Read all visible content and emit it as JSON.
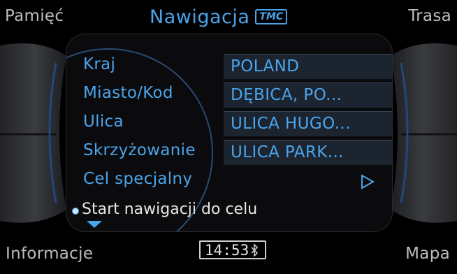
{
  "corners": {
    "top_left": "Pamięć",
    "top_right": "Trasa",
    "bottom_left": "Informacje",
    "bottom_right": "Mapa"
  },
  "header": {
    "title": "Nawigacja",
    "badge": "TMC"
  },
  "form": {
    "rows": [
      {
        "label": "Kraj",
        "value": "POLAND"
      },
      {
        "label": "Miasto/Kod",
        "value": "DĘBICA, PO..."
      },
      {
        "label": "Ulica",
        "value": "ULICA HUGO..."
      },
      {
        "label": "Skrzyżowanie",
        "value": "ULICA PARK..."
      }
    ],
    "special_label": "Cel specjalny",
    "start_label": "Start nawigacji do celu"
  },
  "status": {
    "time": "14:53",
    "icons": [
      "bluetooth-icon"
    ]
  },
  "colors": {
    "accent": "#4aa4ea",
    "field_bg": "#1c2430",
    "background": "#000000"
  }
}
